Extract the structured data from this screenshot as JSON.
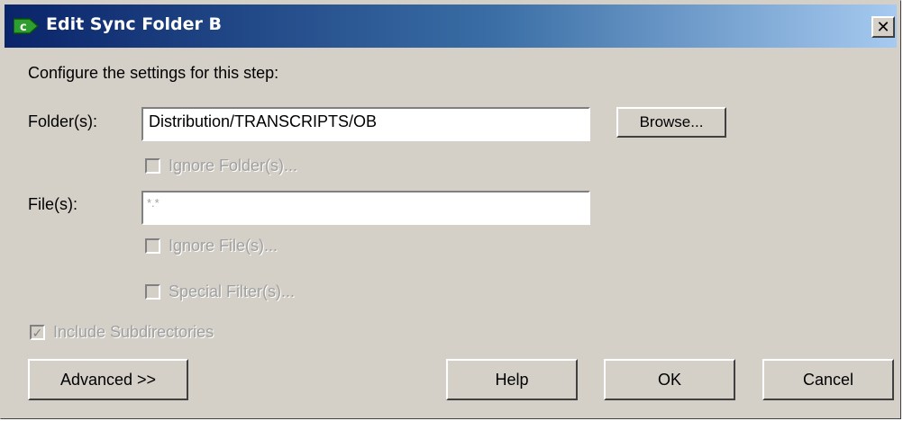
{
  "window": {
    "title": "Edit Sync Folder B",
    "icon": "app-c-icon",
    "close_symbol": "✕"
  },
  "instructions": "Configure the settings for this step:",
  "folders": {
    "label": "Folder(s):",
    "value": "Distribution/TRANSCRIPTS/OB",
    "browse_label": "Browse..."
  },
  "ignore_folders": {
    "label": "Ignore Folder(s)...",
    "checked": false,
    "enabled": false
  },
  "files": {
    "label": "File(s):",
    "value": "*.*"
  },
  "ignore_files": {
    "label": "Ignore File(s)...",
    "checked": false,
    "enabled": false
  },
  "special_filters": {
    "label": "Special Filter(s)...",
    "checked": false,
    "enabled": false
  },
  "include_subdirs": {
    "label": "Include Subdirectories",
    "checked": true,
    "enabled": false,
    "check_mark": "✓"
  },
  "buttons": {
    "advanced": "Advanced >>",
    "help": "Help",
    "ok": "OK",
    "cancel": "Cancel"
  },
  "colors": {
    "dialog_bg": "#d4d0c8",
    "title_gradient_start": "#0a246a",
    "title_gradient_end": "#a6caf0",
    "disabled_text": "#a0a0a0"
  }
}
